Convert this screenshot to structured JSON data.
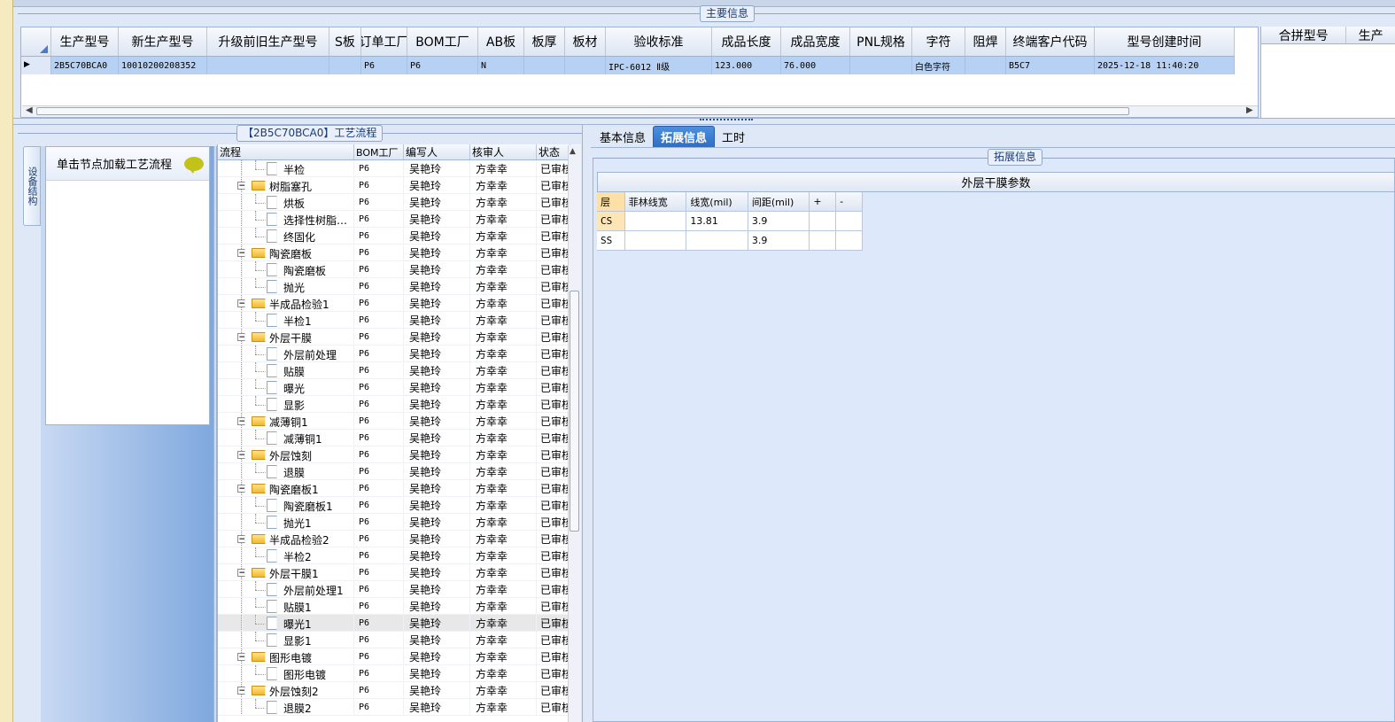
{
  "main_info": {
    "legend": "主要信息",
    "columns": [
      "生产型号",
      "新生产型号",
      "升级前旧生产型号",
      "S板",
      "订单工厂",
      "BOM工厂",
      "AB板",
      "板厚",
      "板材",
      "验收标准",
      "成品长度",
      "成品宽度",
      "PNL规格",
      "字符",
      "阻焊",
      "终端客户代码",
      "型号创建时间"
    ],
    "row": [
      "2B5C70BCA0",
      "10010200208352",
      "",
      "",
      "P6",
      "P6",
      "N",
      "",
      "",
      "IPC-6012 Ⅱ级",
      "123.000",
      "76.000",
      "",
      "白色字符",
      "",
      "B5C7",
      "2025-12-18 11:40:20"
    ],
    "side_columns": [
      "合拼型号",
      "生产"
    ]
  },
  "process_panel": {
    "legend": "【2B5C70BCA0】工艺流程",
    "vertical_tab": "设备结构",
    "hint": "单击节点加载工艺流程",
    "columns": [
      "流程",
      "BOM工厂",
      "编写人",
      "核审人",
      "状态"
    ],
    "rows": [
      {
        "name": "半检",
        "level": 2,
        "bom": "P6",
        "writer": "吴艳玲",
        "reviewer": "方幸幸",
        "status": "已审核"
      },
      {
        "name": "树脂塞孔",
        "level": 1,
        "bom": "P6",
        "writer": "吴艳玲",
        "reviewer": "方幸幸",
        "status": "已审核"
      },
      {
        "name": "烘板",
        "level": 2,
        "bom": "P6",
        "writer": "吴艳玲",
        "reviewer": "方幸幸",
        "status": "已审核"
      },
      {
        "name": "选择性树脂…",
        "level": 2,
        "bom": "P6",
        "writer": "吴艳玲",
        "reviewer": "方幸幸",
        "status": "已审核"
      },
      {
        "name": "终固化",
        "level": 2,
        "bom": "P6",
        "writer": "吴艳玲",
        "reviewer": "方幸幸",
        "status": "已审核"
      },
      {
        "name": "陶瓷磨板",
        "level": 1,
        "bom": "P6",
        "writer": "吴艳玲",
        "reviewer": "方幸幸",
        "status": "已审核"
      },
      {
        "name": "陶瓷磨板",
        "level": 2,
        "bom": "P6",
        "writer": "吴艳玲",
        "reviewer": "方幸幸",
        "status": "已审核"
      },
      {
        "name": "抛光",
        "level": 2,
        "bom": "P6",
        "writer": "吴艳玲",
        "reviewer": "方幸幸",
        "status": "已审核"
      },
      {
        "name": "半成品检验1",
        "level": 1,
        "bom": "P6",
        "writer": "吴艳玲",
        "reviewer": "方幸幸",
        "status": "已审核"
      },
      {
        "name": "半检1",
        "level": 2,
        "bom": "P6",
        "writer": "吴艳玲",
        "reviewer": "方幸幸",
        "status": "已审核"
      },
      {
        "name": "外层干膜",
        "level": 1,
        "bom": "P6",
        "writer": "吴艳玲",
        "reviewer": "方幸幸",
        "status": "已审核"
      },
      {
        "name": "外层前处理",
        "level": 2,
        "bom": "P6",
        "writer": "吴艳玲",
        "reviewer": "方幸幸",
        "status": "已审核"
      },
      {
        "name": "贴膜",
        "level": 2,
        "bom": "P6",
        "writer": "吴艳玲",
        "reviewer": "方幸幸",
        "status": "已审核"
      },
      {
        "name": "曝光",
        "level": 2,
        "bom": "P6",
        "writer": "吴艳玲",
        "reviewer": "方幸幸",
        "status": "已审核"
      },
      {
        "name": "显影",
        "level": 2,
        "bom": "P6",
        "writer": "吴艳玲",
        "reviewer": "方幸幸",
        "status": "已审核"
      },
      {
        "name": "减薄铜1",
        "level": 1,
        "bom": "P6",
        "writer": "吴艳玲",
        "reviewer": "方幸幸",
        "status": "已审核"
      },
      {
        "name": "减薄铜1",
        "level": 2,
        "bom": "P6",
        "writer": "吴艳玲",
        "reviewer": "方幸幸",
        "status": "已审核"
      },
      {
        "name": "外层蚀刻",
        "level": 1,
        "bom": "P6",
        "writer": "吴艳玲",
        "reviewer": "方幸幸",
        "status": "已审核"
      },
      {
        "name": "退膜",
        "level": 2,
        "bom": "P6",
        "writer": "吴艳玲",
        "reviewer": "方幸幸",
        "status": "已审核"
      },
      {
        "name": "陶瓷磨板1",
        "level": 1,
        "bom": "P6",
        "writer": "吴艳玲",
        "reviewer": "方幸幸",
        "status": "已审核"
      },
      {
        "name": "陶瓷磨板1",
        "level": 2,
        "bom": "P6",
        "writer": "吴艳玲",
        "reviewer": "方幸幸",
        "status": "已审核"
      },
      {
        "name": "抛光1",
        "level": 2,
        "bom": "P6",
        "writer": "吴艳玲",
        "reviewer": "方幸幸",
        "status": "已审核"
      },
      {
        "name": "半成品检验2",
        "level": 1,
        "bom": "P6",
        "writer": "吴艳玲",
        "reviewer": "方幸幸",
        "status": "已审核"
      },
      {
        "name": "半检2",
        "level": 2,
        "bom": "P6",
        "writer": "吴艳玲",
        "reviewer": "方幸幸",
        "status": "已审核"
      },
      {
        "name": "外层干膜1",
        "level": 1,
        "bom": "P6",
        "writer": "吴艳玲",
        "reviewer": "方幸幸",
        "status": "已审核"
      },
      {
        "name": "外层前处理1",
        "level": 2,
        "bom": "P6",
        "writer": "吴艳玲",
        "reviewer": "方幸幸",
        "status": "已审核"
      },
      {
        "name": "贴膜1",
        "level": 2,
        "bom": "P6",
        "writer": "吴艳玲",
        "reviewer": "方幸幸",
        "status": "已审核"
      },
      {
        "name": "曝光1",
        "level": 2,
        "bom": "P6",
        "writer": "吴艳玲",
        "reviewer": "方幸幸",
        "status": "已审核",
        "selected": true
      },
      {
        "name": "显影1",
        "level": 2,
        "bom": "P6",
        "writer": "吴艳玲",
        "reviewer": "方幸幸",
        "status": "已审核"
      },
      {
        "name": "图形电镀",
        "level": 1,
        "bom": "P6",
        "writer": "吴艳玲",
        "reviewer": "方幸幸",
        "status": "已审核"
      },
      {
        "name": "图形电镀",
        "level": 2,
        "bom": "P6",
        "writer": "吴艳玲",
        "reviewer": "方幸幸",
        "status": "已审核"
      },
      {
        "name": "外层蚀刻2",
        "level": 1,
        "bom": "P6",
        "writer": "吴艳玲",
        "reviewer": "方幸幸",
        "status": "已审核"
      },
      {
        "name": "退膜2",
        "level": 2,
        "bom": "P6",
        "writer": "吴艳玲",
        "reviewer": "方幸幸",
        "status": "已审核"
      }
    ]
  },
  "right_panel": {
    "tabs": [
      "基本信息",
      "拓展信息",
      "工时"
    ],
    "active_tab": "拓展信息",
    "legend": "拓展信息",
    "title": "外层干膜参数",
    "columns": [
      "层",
      "菲林线宽",
      "线宽(mil)",
      "间距(mil)",
      "+",
      "-"
    ],
    "rows": [
      [
        "CS",
        "",
        "13.81",
        "3.9",
        "",
        ""
      ],
      [
        "SS",
        "",
        "",
        "3.9",
        "",
        ""
      ]
    ]
  },
  "colors": {
    "selection": "#b6d1f3",
    "active_tab": "#2d6fc7",
    "layer_header": "#fde0a8",
    "bubble": "#c3c21b"
  }
}
